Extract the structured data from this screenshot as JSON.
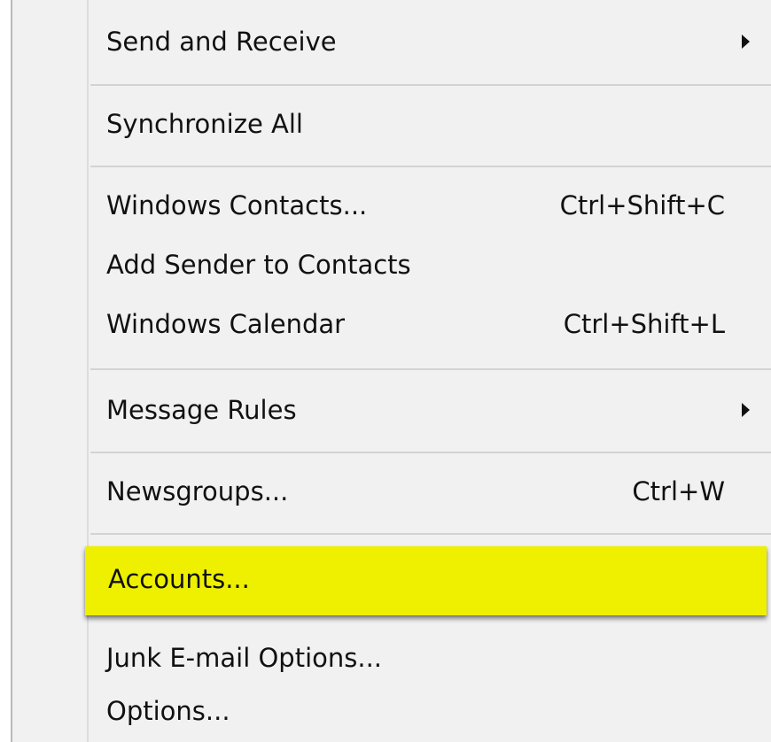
{
  "menu": {
    "items": [
      {
        "label": "Send and Receive",
        "submenu_arrow": "triangle-right-icon"
      },
      {
        "label": "Synchronize All"
      },
      {
        "label": "Windows Contacts...",
        "shortcut": "Ctrl+Shift+C"
      },
      {
        "label": "Add Sender to Contacts"
      },
      {
        "label": "Windows Calendar",
        "shortcut": "Ctrl+Shift+L"
      },
      {
        "label": "Message Rules",
        "submenu_arrow": "triangle-right-icon"
      },
      {
        "label": "Newsgroups...",
        "shortcut": "Ctrl+W"
      },
      {
        "label": "Accounts...",
        "highlighted": true
      },
      {
        "label": "Junk E-mail Options..."
      },
      {
        "label": "Options..."
      }
    ],
    "highlight_color": "#eef000"
  }
}
